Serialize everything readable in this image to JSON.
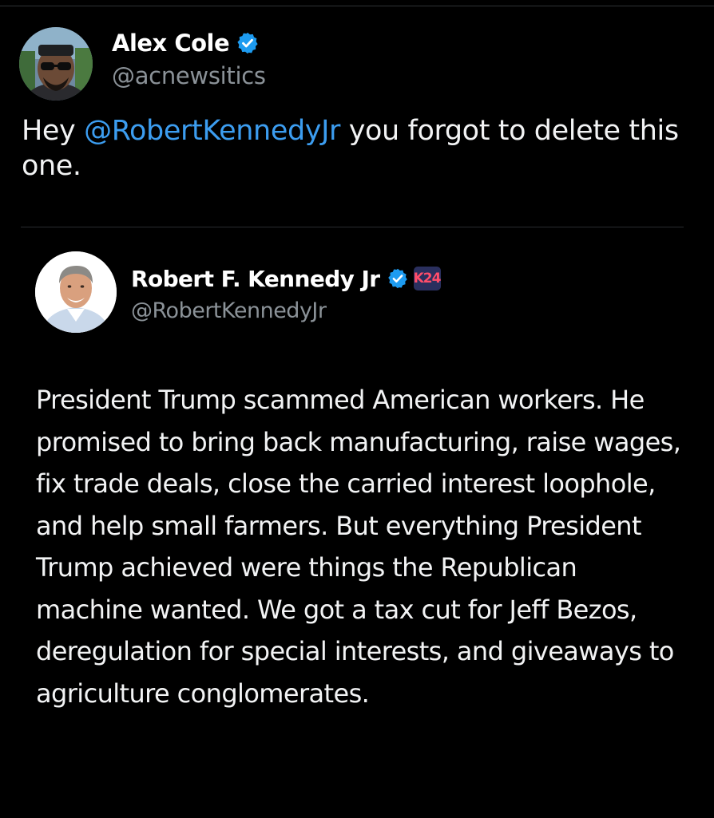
{
  "tweet": {
    "author": {
      "display_name": "Alex Cole",
      "handle": "@acnewsitics",
      "verified": true,
      "avatar_icon": "avatar-photo-man-sunglasses"
    },
    "text": {
      "prefix": "Hey ",
      "mention": "@RobertKennedyJr",
      "suffix": " you forgot to delete this one."
    },
    "quoted_tweet": {
      "author": {
        "display_name": "Robert F. Kennedy Jr",
        "handle": "@RobertKennedyJr",
        "verified": true,
        "affiliate_badge": "K24",
        "avatar_icon": "avatar-photo-man-smiling"
      },
      "text": "President Trump scammed American workers. He promised to bring back manufacturing, raise wages, fix trade deals, close the carried interest loophole, and help small farmers. But everything President Trump achieved were things the Republican machine wanted. We got a tax cut for Jeff Bezos, deregulation for special interests, and giveaways to agriculture conglomerates."
    }
  },
  "colors": {
    "background": "#000000",
    "text": "#e7e9ea",
    "secondary_text": "#8b9298",
    "mention": "#3c9df0",
    "verified": "#1d9bf0",
    "divider": "#2f3336"
  }
}
